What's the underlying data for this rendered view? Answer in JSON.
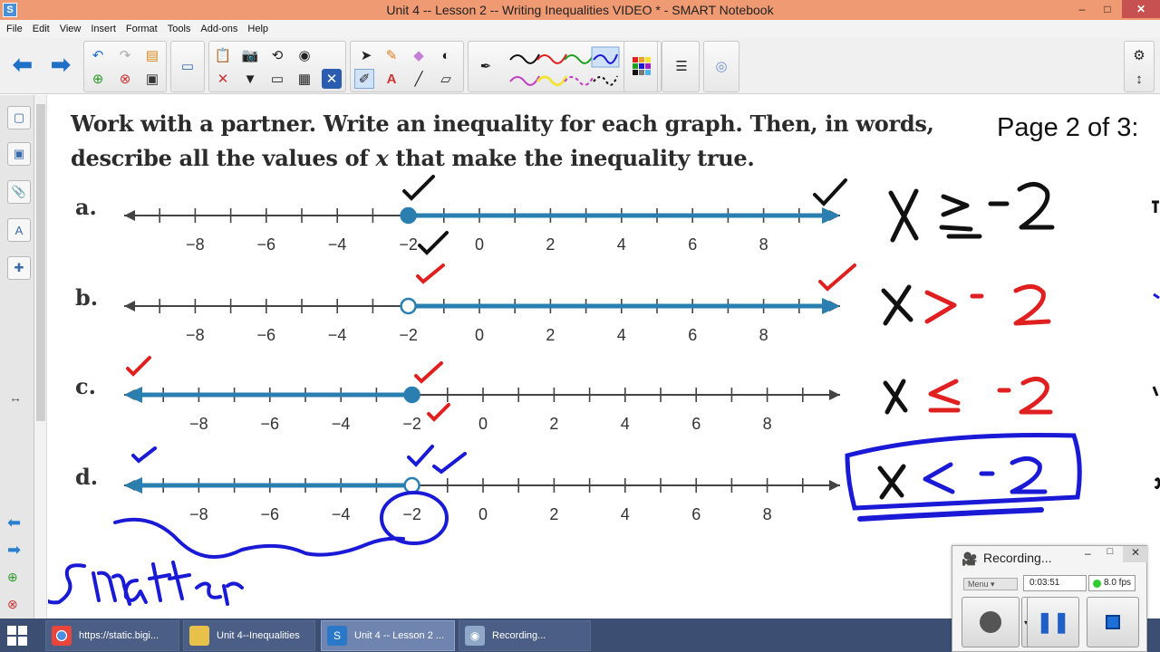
{
  "window": {
    "title": "Unit 4 -- Lesson 2 -- Writing Inequalities VIDEO * - SMART Notebook",
    "controls": {
      "minimize": "–",
      "maximize": "□",
      "close": "✕"
    }
  },
  "menu": [
    "File",
    "Edit",
    "View",
    "Insert",
    "Format",
    "Tools",
    "Add-ons",
    "Help"
  ],
  "canvas": {
    "heading_line1": "Work with a partner. Write an inequality for each graph. Then, in words,",
    "heading_line2_before": "describe all the values of ",
    "heading_line2_var": "x",
    "heading_line2_after": " that make the inequality true.",
    "page_indicator": "Page 2 of 3:",
    "graphs": [
      {
        "label": "a.",
        "boundary": -2,
        "closed": true,
        "direction": "right",
        "answer_written": "x ≥ -2",
        "ink_color": "#000000"
      },
      {
        "label": "b.",
        "boundary": -2,
        "closed": false,
        "direction": "right",
        "answer_written": "x > -2",
        "ink_color": "#e02020"
      },
      {
        "label": "c.",
        "boundary": -2,
        "closed": true,
        "direction": "left",
        "answer_written": "x ≤ -2",
        "ink_color": "#e02020"
      },
      {
        "label": "d.",
        "boundary": -2,
        "closed": false,
        "direction": "left",
        "answer_written": "x < -2",
        "ink_color": "#1a1ad6"
      }
    ],
    "tick_labels": [
      "−8",
      "−6",
      "−4",
      "−2",
      "0",
      "2",
      "4",
      "6",
      "8"
    ],
    "annotation_word": "smaller"
  },
  "taskbar": {
    "items": [
      {
        "label": "https://static.bigi...",
        "icon": "chrome-icon"
      },
      {
        "label": "Unit 4--Inequalities",
        "icon": "folder-icon"
      },
      {
        "label": "Unit 4 -- Lesson 2 ...",
        "icon": "smart-notebook-icon"
      },
      {
        "label": "Recording...",
        "icon": "recorder-icon"
      }
    ]
  },
  "recording": {
    "title": "Recording...",
    "menu": "Menu",
    "elapsed": "0:03:51",
    "fps": "8.0 fps"
  },
  "colors": {
    "titlebar": "#ef9a72",
    "graph_line": "#2a7fb0",
    "taskbar": "#3c4f73"
  }
}
